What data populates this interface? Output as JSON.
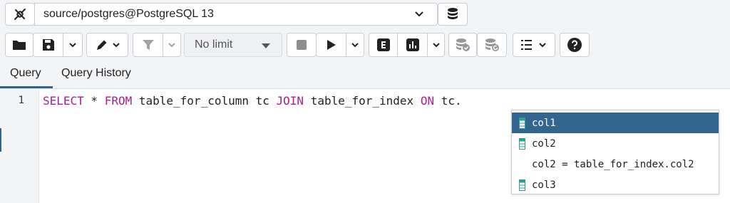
{
  "connection": {
    "label": "source/postgres@PostgreSQL 13"
  },
  "toolbar": {
    "limit_value": "No limit"
  },
  "tabs": [
    {
      "label": "Query",
      "active": true
    },
    {
      "label": "Query History",
      "active": false
    }
  ],
  "editor": {
    "line_number": "1",
    "tokens": {
      "select_kw": "SELECT",
      "star": " * ",
      "from_kw": "FROM",
      "t1": " table_for_column tc ",
      "join_kw": "JOIN",
      "t2": " table_for_index ",
      "on_kw": "ON",
      "tail": " tc."
    }
  },
  "autocomplete": {
    "items": [
      {
        "label": "col1",
        "icon": "column-icon",
        "selected": true
      },
      {
        "label": "col2",
        "icon": "column-icon",
        "selected": false
      },
      {
        "label": "col2 = table_for_index.col2",
        "icon": "",
        "selected": false
      },
      {
        "label": "col3",
        "icon": "column-icon",
        "selected": false
      }
    ]
  },
  "colors": {
    "accent": "#326690",
    "keyword": "#a8228c",
    "column_icon": "#2f9e8f"
  }
}
